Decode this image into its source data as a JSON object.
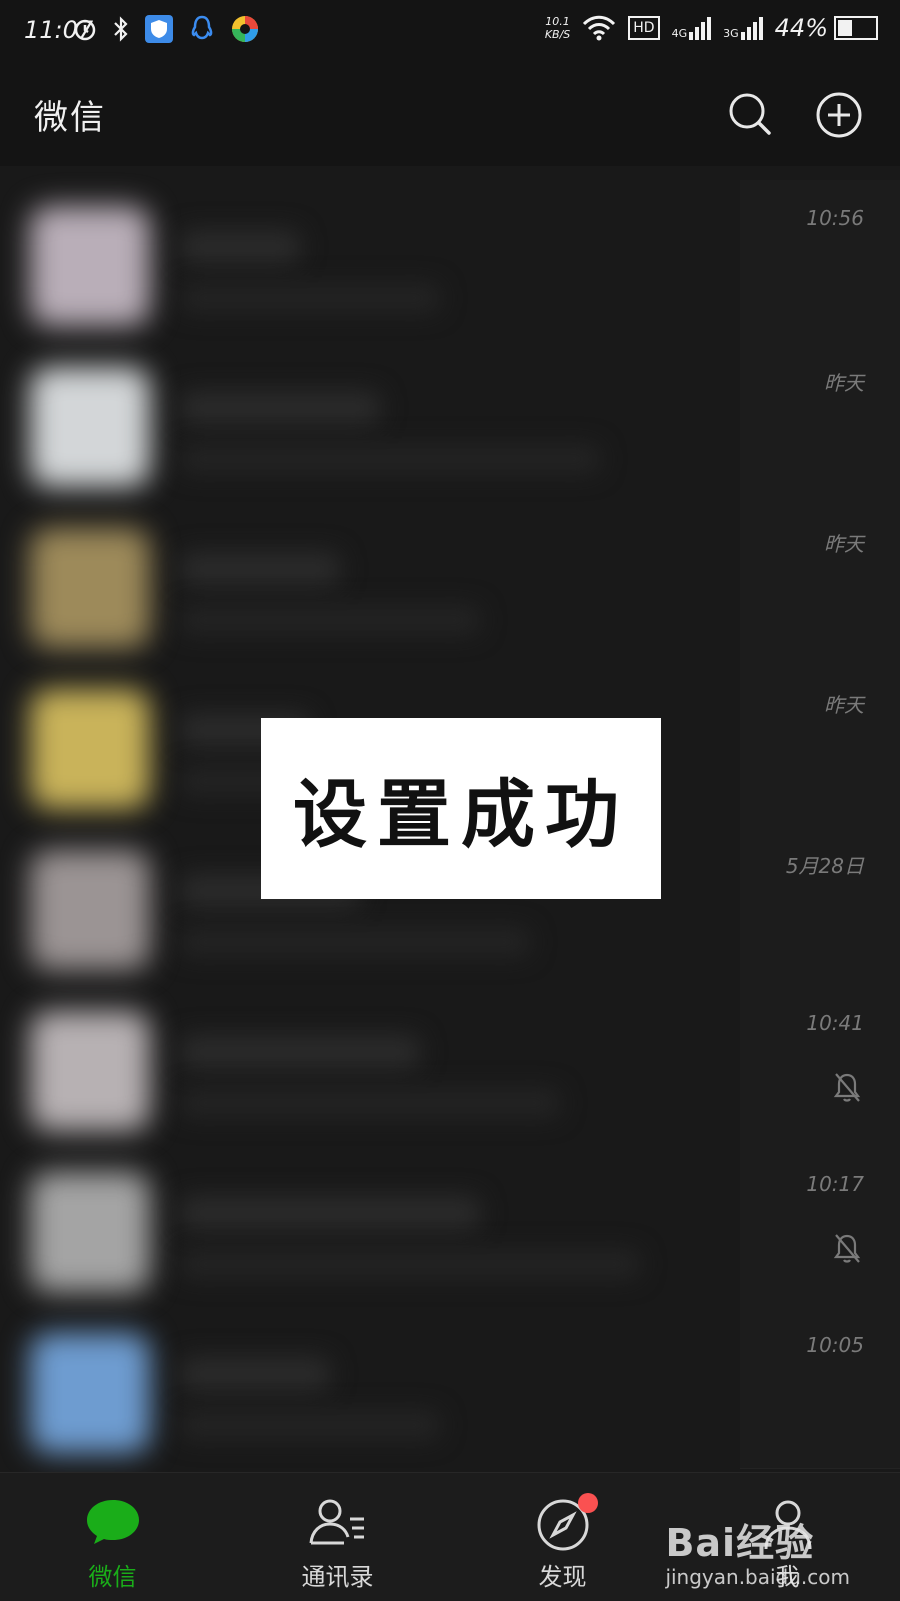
{
  "status_bar": {
    "time": "11:07",
    "speed_value": "10.1",
    "speed_unit": "KB/S",
    "hd": "HD",
    "net1": "4G",
    "net2": "3G",
    "battery": "44%",
    "battery_level": 0.44
  },
  "header": {
    "title": "微信"
  },
  "chats": [
    {
      "time": "10:56",
      "muted": false,
      "avatar_color": "#b9aeb8"
    },
    {
      "time": "昨天",
      "muted": false,
      "avatar_color": "#d3d6d8"
    },
    {
      "time": "昨天",
      "muted": false,
      "avatar_color": "#9d8a5a"
    },
    {
      "time": "昨天",
      "muted": false,
      "avatar_color": "#c9b35a"
    },
    {
      "time": "5月28日",
      "muted": false,
      "avatar_color": "#9b9494"
    },
    {
      "time": "10:41",
      "muted": true,
      "avatar_color": "#b7b1b3"
    },
    {
      "time": "10:17",
      "muted": true,
      "avatar_color": "#a4a4a4"
    },
    {
      "time": "10:05",
      "muted": false,
      "avatar_color": "#6e9cd0"
    }
  ],
  "toast": {
    "text": "设置成功"
  },
  "tabs": [
    {
      "label": "微信",
      "icon": "chat-bubble-icon",
      "active": true
    },
    {
      "label": "通讯录",
      "icon": "contacts-icon",
      "active": false
    },
    {
      "label": "发现",
      "icon": "compass-icon",
      "active": false
    },
    {
      "label": "我",
      "icon": "person-icon",
      "active": false
    }
  ],
  "watermark": {
    "line1": "Bai经验",
    "line2": "jingyan.baidu.com"
  },
  "colors": {
    "accent": "#1aad19",
    "badge": "#fa5151"
  }
}
